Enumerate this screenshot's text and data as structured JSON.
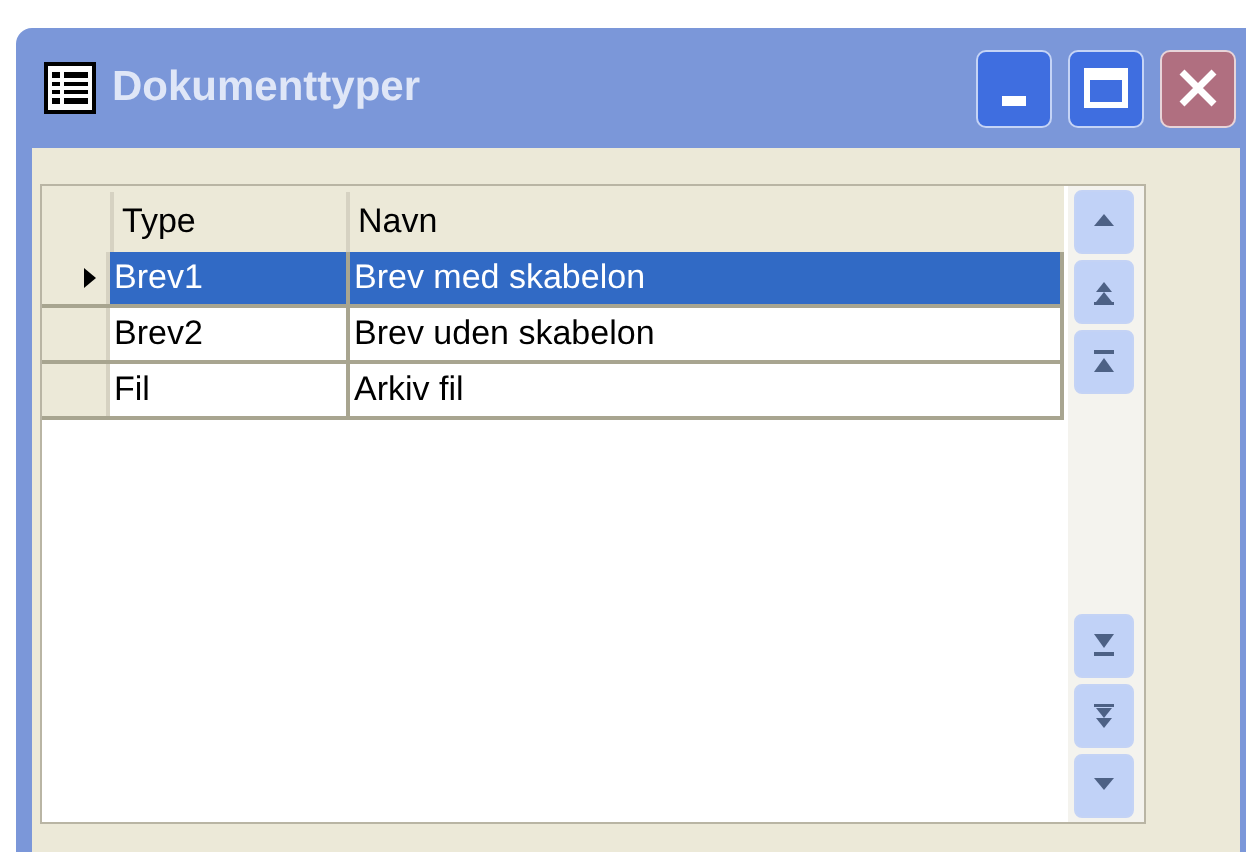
{
  "window": {
    "title": "Dokumenttyper"
  },
  "table": {
    "columns": [
      "Type",
      "Navn"
    ],
    "rows": [
      {
        "cells": [
          "Brev1",
          "Brev med skabelon"
        ],
        "selected": true
      },
      {
        "cells": [
          "Brev2",
          "Brev uden skabelon"
        ],
        "selected": false
      },
      {
        "cells": [
          "Fil",
          "Arkiv fil"
        ],
        "selected": false
      }
    ]
  },
  "scroll_buttons": [
    {
      "kind": "up"
    },
    {
      "kind": "page-up"
    },
    {
      "kind": "top"
    },
    {
      "kind": "bottom"
    },
    {
      "kind": "page-down"
    },
    {
      "kind": "down"
    }
  ]
}
